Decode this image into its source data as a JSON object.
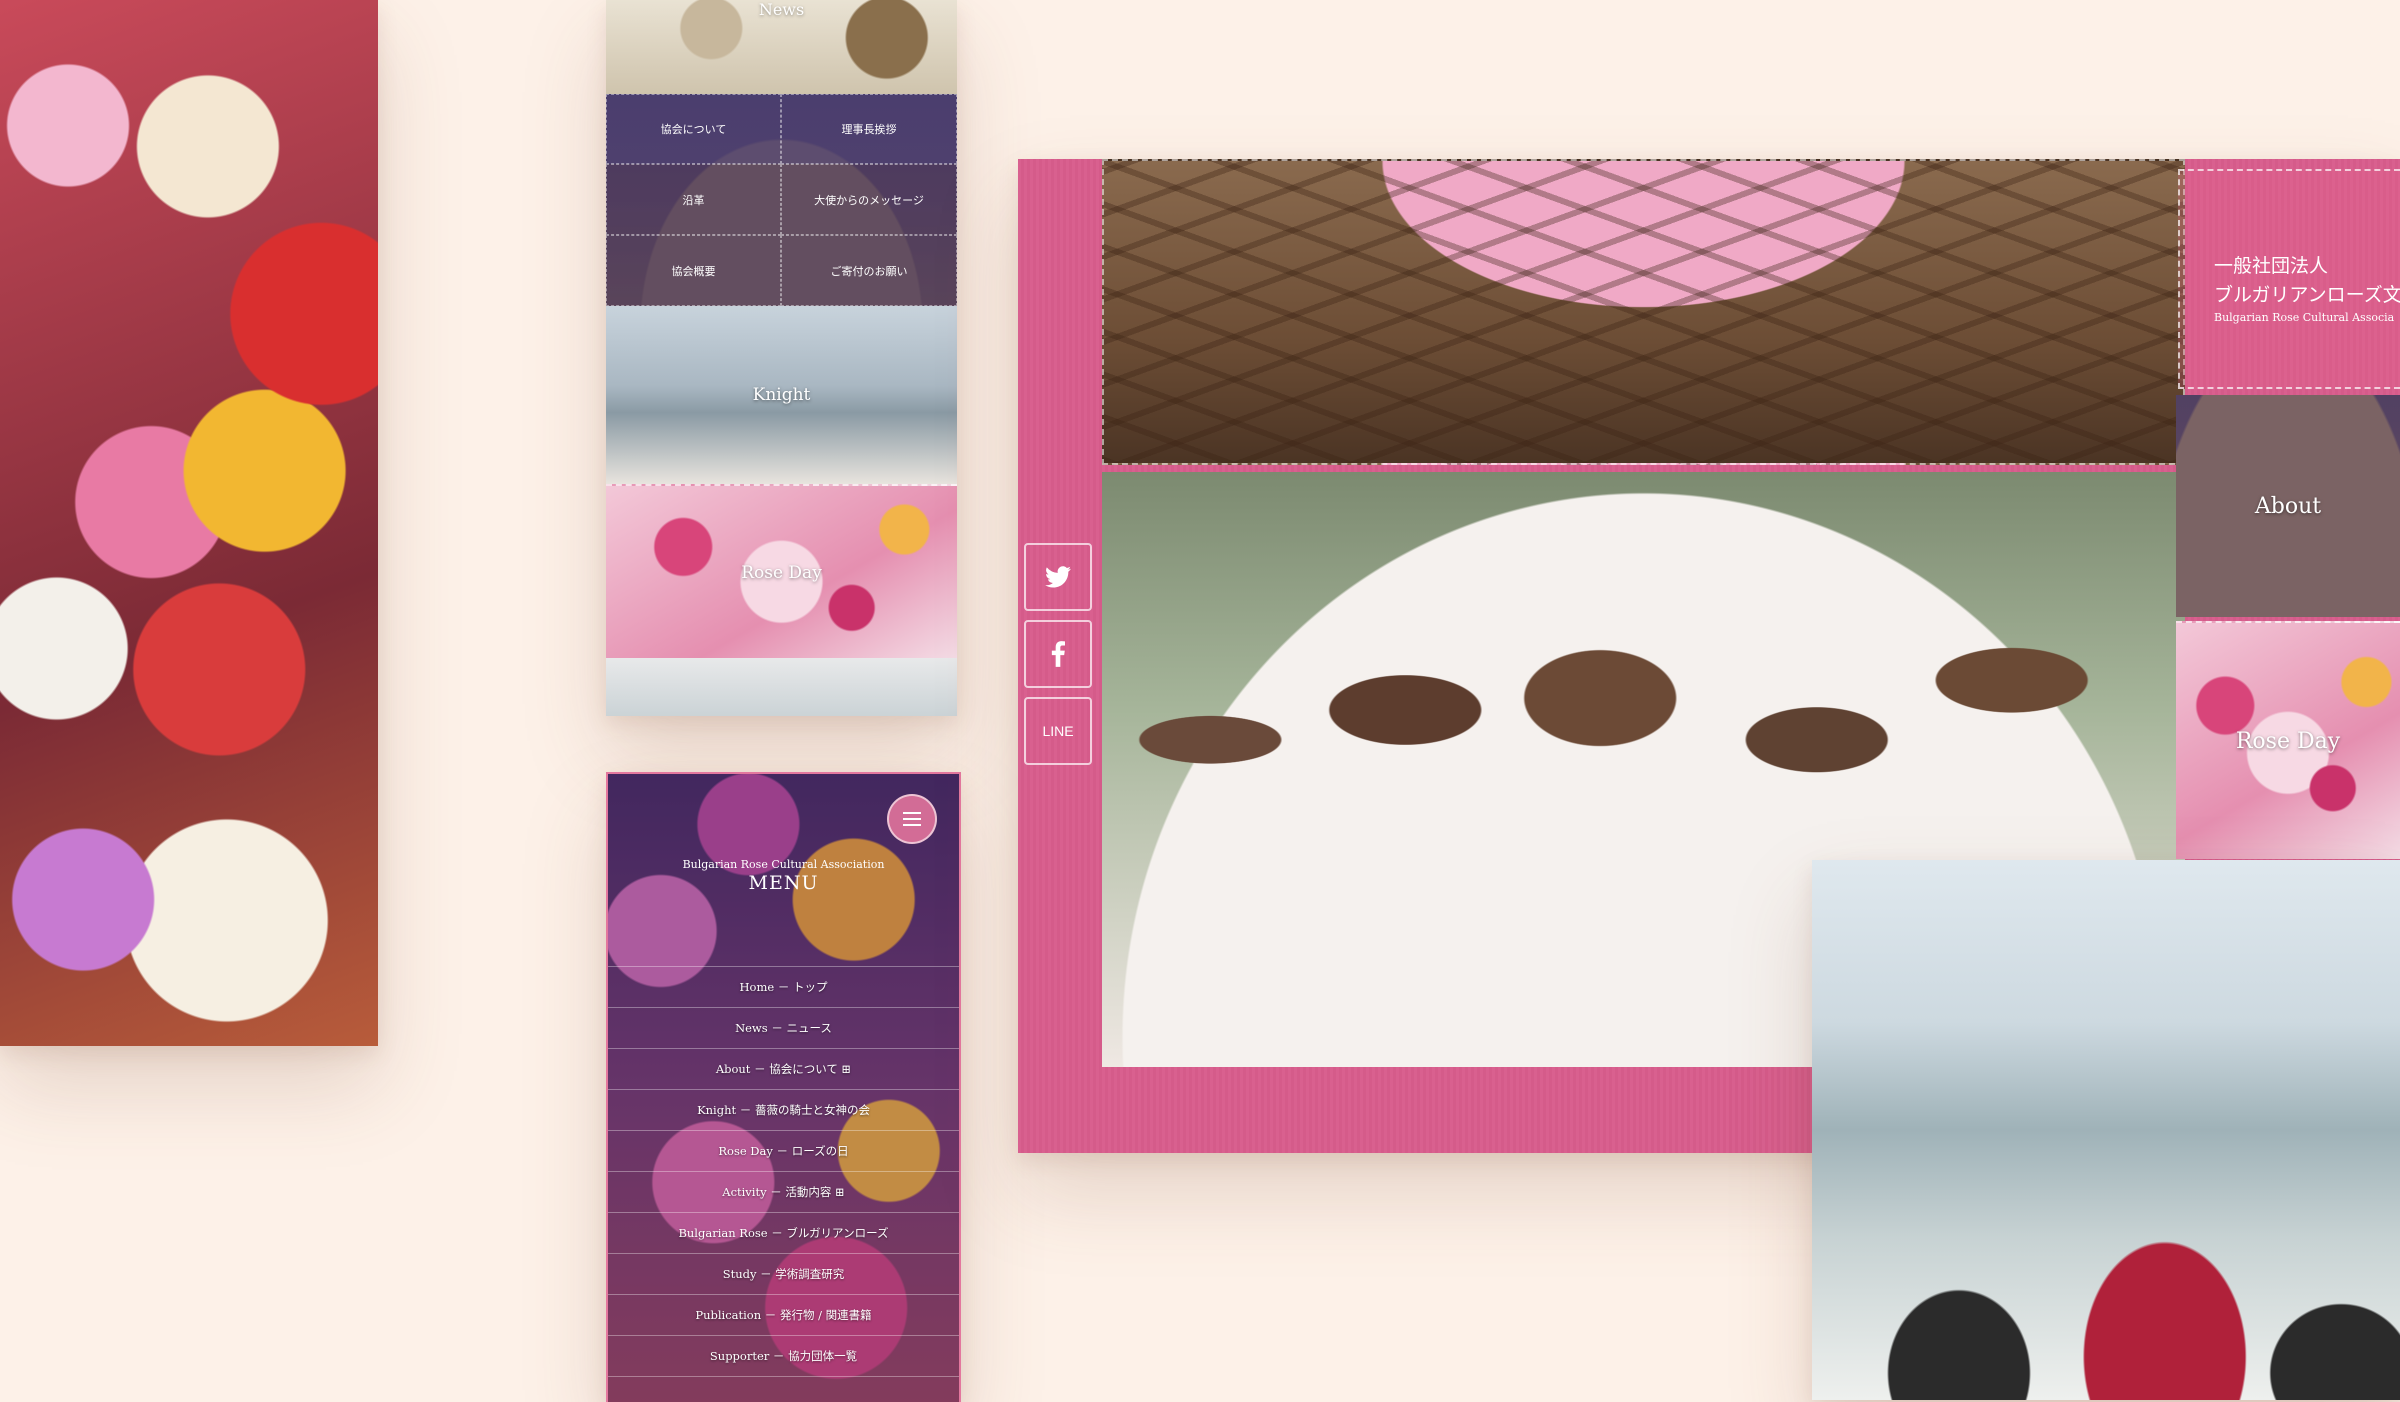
{
  "phone_top": {
    "news_label": "News",
    "grid": [
      "協会について",
      "理事長挨拶",
      "沿革",
      "大使からのメッセージ",
      "協会概要",
      "ご寄付のお願い"
    ],
    "knight_label": "Knight",
    "roseday_label": "Rose Day"
  },
  "phone_menu": {
    "org_name": "Bulgarian Rose Cultural Association",
    "title": "MENU",
    "items": [
      "Home － トップ",
      "News － ニュース",
      "About － 協会について ⊞",
      "Knight － 薔薇の騎士と女神の会",
      "Rose Day － ローズの日",
      "Activity － 活動内容 ⊞",
      "Bulgarian Rose － ブルガリアンローズ",
      "Study － 学術調査研究",
      "Publication － 発行物 / 関連書籍",
      "Supporter － 協力団体一覧"
    ]
  },
  "desktop": {
    "social": {
      "twitter_icon": "twitter-icon",
      "facebook_icon": "facebook-icon",
      "line_label": "LINE"
    },
    "org_line1": "一般社団法人",
    "org_line2": "ブルガリアンローズ文化",
    "org_line3": "Bulgarian Rose Cultural Associa",
    "about_label": "About",
    "roseday_label": "Rose Day"
  },
  "colors": {
    "page_bg": "#fdf1e8",
    "accent_pink": "#d9608f",
    "menu_border": "#e3779e"
  }
}
